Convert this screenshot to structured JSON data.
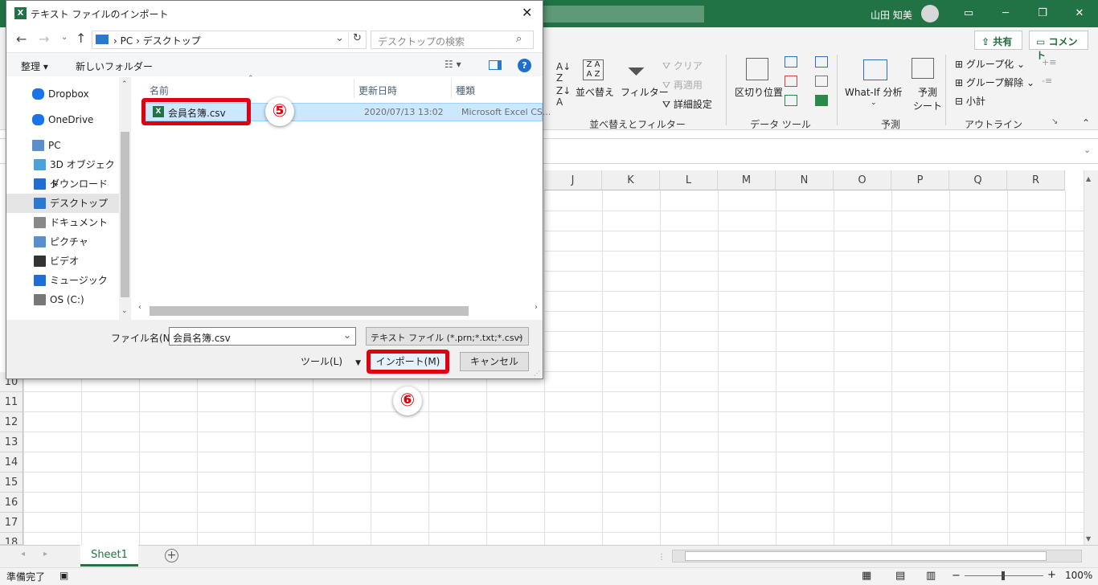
{
  "excel": {
    "user_name": "山田 知美",
    "share_label": "共有",
    "comment_label": "コメント",
    "ribbon": {
      "sort_label": "並べ替え",
      "filter_label": "フィルター",
      "clear_label": "クリア",
      "reapply_label": "再適用",
      "advanced_label": "詳細設定",
      "group_sort_filter": "並べ替えとフィルター",
      "text_to_columns_label": "区切り位置",
      "group_data_tools": "データ ツール",
      "whatif_label": "What-If 分析",
      "forecast_label": "予測\nシート",
      "forecast_line1": "予測",
      "forecast_line2": "シート",
      "group_forecast": "予測",
      "group_label": "グループ化",
      "ungroup_label": "グループ解除",
      "subtotal_label": "小計",
      "group_outline": "アウトライン"
    },
    "columns": [
      "J",
      "K",
      "L",
      "M",
      "N",
      "O",
      "P",
      "Q",
      "R"
    ],
    "rows": [
      "10",
      "11",
      "12",
      "13",
      "14",
      "15",
      "16",
      "17",
      "18"
    ],
    "sheet_tab": "Sheet1",
    "status_ready": "準備完了",
    "zoom": "100%"
  },
  "dialog": {
    "title": "テキスト ファイルのインポート",
    "breadcrumb": [
      "PC",
      "デスクトップ"
    ],
    "search_placeholder": "デスクトップの検索",
    "organize_label": "整理",
    "new_folder_label": "新しいフォルダー",
    "sidebar": [
      {
        "label": "Dropbox",
        "icon": "dropbox-icon"
      },
      {
        "label": "OneDrive",
        "icon": "cloud-icon"
      },
      {
        "label": "PC",
        "icon": "pc-icon"
      },
      {
        "label": "3D オブジェクト",
        "icon": "cube-icon"
      },
      {
        "label": "ダウンロード",
        "icon": "download-icon"
      },
      {
        "label": "デスクトップ",
        "icon": "desktop-icon"
      },
      {
        "label": "ドキュメント",
        "icon": "document-icon"
      },
      {
        "label": "ピクチャ",
        "icon": "picture-icon"
      },
      {
        "label": "ビデオ",
        "icon": "video-icon"
      },
      {
        "label": "ミュージック",
        "icon": "music-icon"
      },
      {
        "label": "OS (C:)",
        "icon": "drive-icon"
      }
    ],
    "columns": {
      "name": "名前",
      "date": "更新日時",
      "type": "種類"
    },
    "files": [
      {
        "name": "会員名簿.csv",
        "date": "2020/07/13 13:02",
        "type": "Microsoft Excel CS..."
      }
    ],
    "filename_label": "ファイル名(N):",
    "filename_value": "会員名簿.csv",
    "filetype_value": "テキスト ファイル (*.prn;*.txt;*.csv)",
    "tools_label": "ツール(L)",
    "import_label": "インポート(M)",
    "cancel_label": "キャンセル"
  },
  "annotations": {
    "step5": "⑤",
    "step6": "⑥"
  },
  "colors": {
    "excel_green": "#217346",
    "highlight_red": "#e0000f",
    "selection_blue": "#cce8ff"
  }
}
